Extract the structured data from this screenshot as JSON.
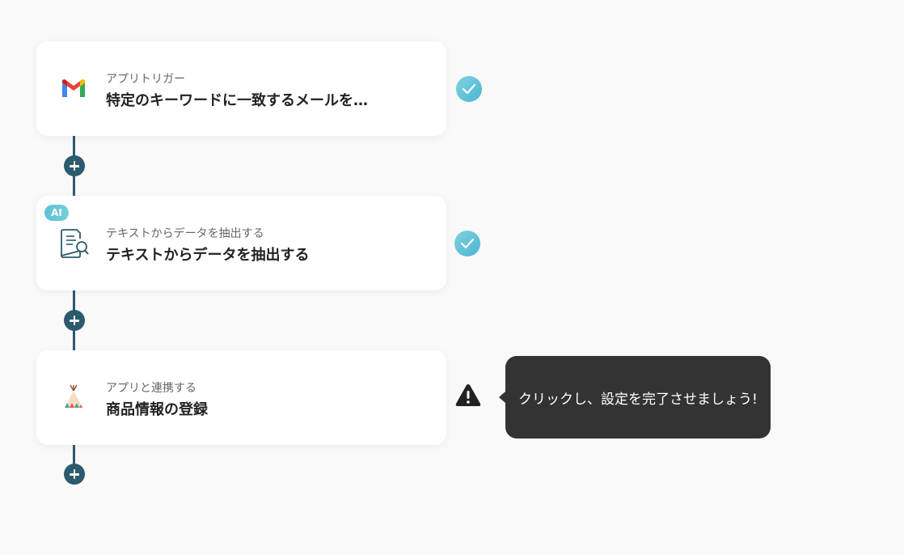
{
  "steps": [
    {
      "subtitle": "アプリトリガー",
      "title": "特定のキーワードに一致するメールを…",
      "status": "complete",
      "icon": "gmail-icon"
    },
    {
      "badge": "AI",
      "subtitle": "テキストからデータを抽出する",
      "title": "テキストからデータを抽出する",
      "status": "complete",
      "icon": "document-search-icon"
    },
    {
      "subtitle": "アプリと連携する",
      "title": "商品情報の登録",
      "status": "incomplete",
      "icon": "teepee-icon"
    }
  ],
  "tooltip": {
    "text": "クリックし、設定を完了させましょう!"
  },
  "colors": {
    "background": "#f9f9f9",
    "connector": "#2c5a6e",
    "check": "#5bc2d6",
    "tooltip_bg": "#333333"
  }
}
